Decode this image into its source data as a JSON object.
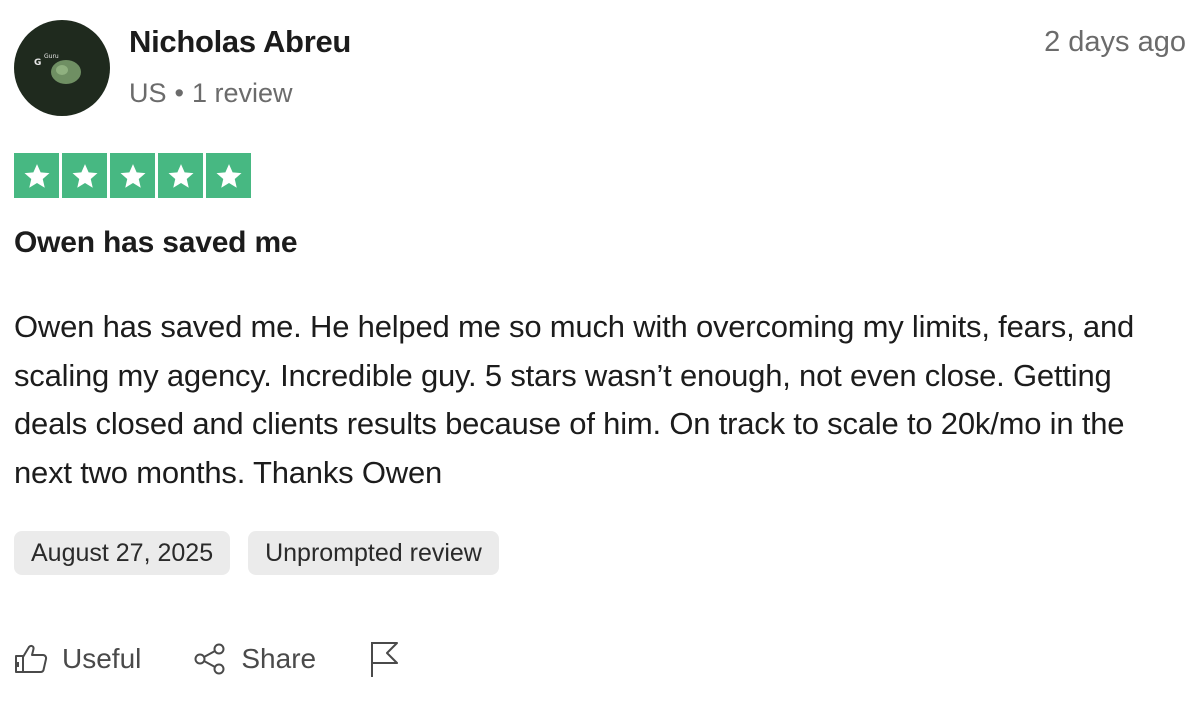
{
  "reviewer": {
    "name": "Nichola s Abreu",
    "country": "US",
    "separator": "•",
    "review_count": "1 review",
    "avatar_text": "GGuru",
    "avatar_letter": "G",
    "avatar_logo_word": "Guru"
  },
  "review": {
    "relative_date": "2 days ago",
    "rating": 5,
    "rating_max": 5,
    "title": "Owen has saved me",
    "body": "Owen has saved me. He helped me so much with overcoming my limits, fears, and scaling my agency. Incredible guy. 5 stars wasn’t enough, not even close. Getting deals closed and clients results because of him. On track to scale to 20k/mo in the next two months. Thanks Owen",
    "tags": [
      "August 27, 2025",
      "Unprompted review"
    ]
  },
  "actions": {
    "useful_label": "Useful",
    "share_label": "Share"
  },
  "icons": {
    "star": "star-icon",
    "useful": "thumbs-up-icon",
    "share": "share-icon",
    "report": "flag-icon"
  },
  "colors": {
    "star_background": "#47b882",
    "avatar_background": "#1f2a1e",
    "tag_background": "#ebebeb",
    "muted_text": "#6b6b6b"
  }
}
